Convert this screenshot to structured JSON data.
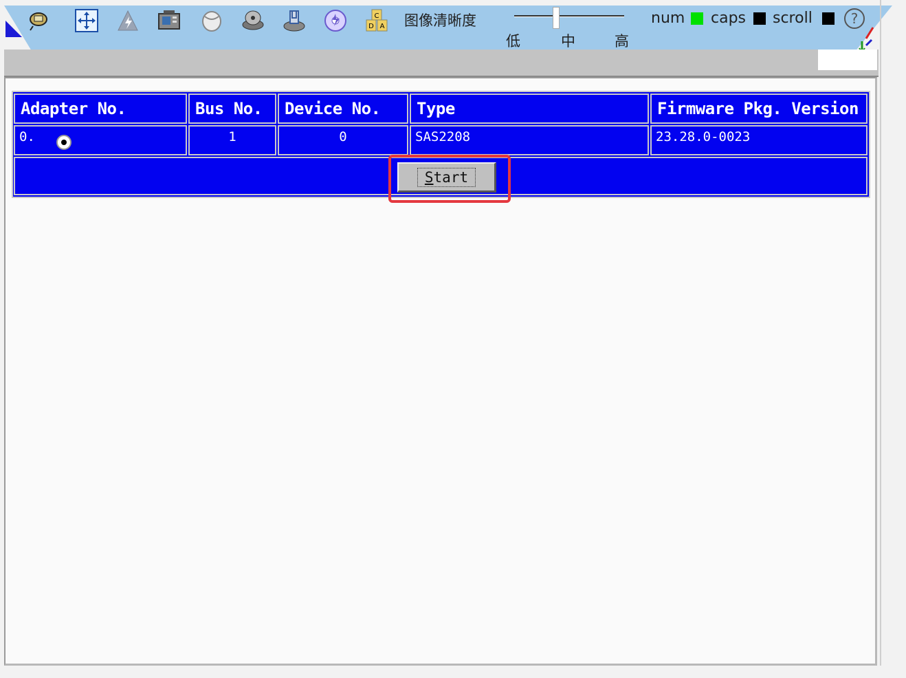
{
  "toolbar": {
    "icons": [
      "keyboard-icon",
      "move-icon",
      "power-icon",
      "media-icon",
      "mouse-icon",
      "disk-icon",
      "floppy-icon",
      "cd-icon",
      "abcd-icon"
    ],
    "quality_label": "图像清晰度",
    "quality_ticks": [
      "低",
      "中",
      "高"
    ],
    "quality_level": "中",
    "locks": {
      "num_label": "num",
      "num_color": "#00e000",
      "caps_label": "caps",
      "caps_color": "#000000",
      "scroll_label": "scroll",
      "scroll_color": "#000000"
    },
    "help_glyph": "?"
  },
  "adapter_table": {
    "headers": [
      "Adapter No.",
      "Bus No.",
      "Device No.",
      "Type",
      "Firmware Pkg. Version"
    ],
    "rows": [
      {
        "adapter_no": "0.",
        "bus_no": "1",
        "device_no": "0",
        "type": "SAS2208",
        "firmware": "23.28.0-0023"
      }
    ],
    "start_label": "Start"
  },
  "colors": {
    "table_blue": "#0202f0",
    "toolbar_blue": "#9fc9ea",
    "highlight_red": "#e4383f"
  }
}
